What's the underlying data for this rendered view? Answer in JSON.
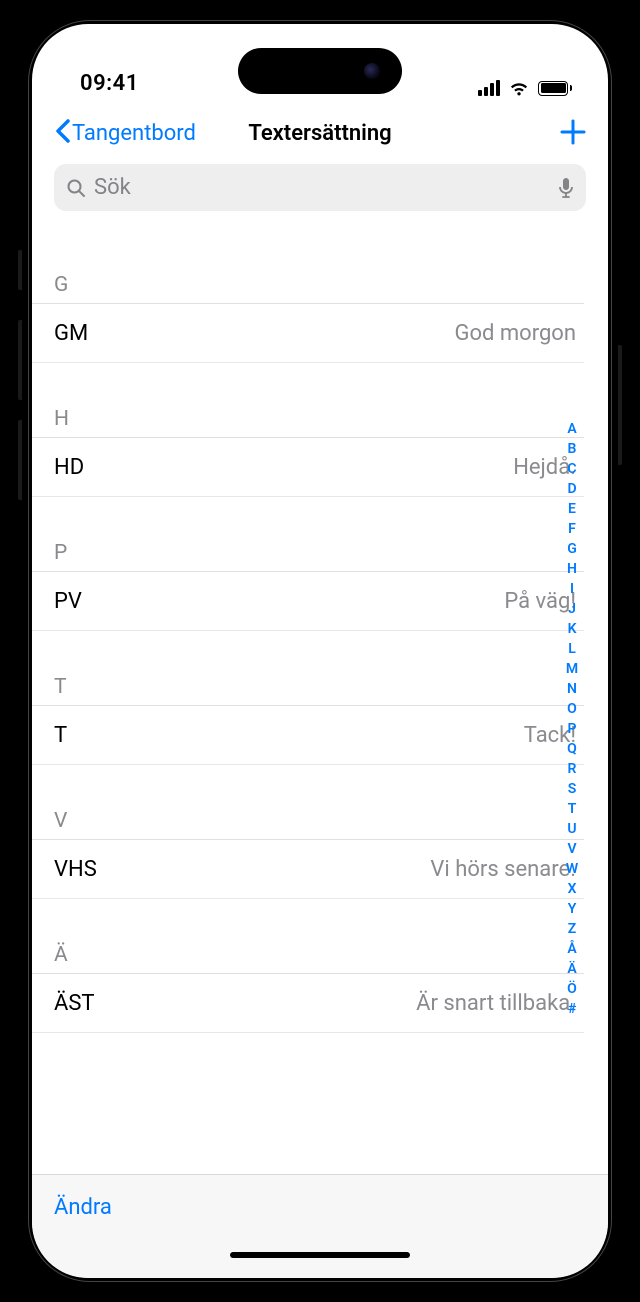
{
  "status": {
    "time": "09:41"
  },
  "nav": {
    "back": "Tangentbord",
    "title": "Textersättning"
  },
  "search": {
    "placeholder": "Sök"
  },
  "sections": [
    {
      "letter": "G",
      "items": [
        {
          "shortcut": "GM",
          "phrase": "God morgon"
        }
      ]
    },
    {
      "letter": "H",
      "items": [
        {
          "shortcut": "HD",
          "phrase": "Hejdå."
        }
      ]
    },
    {
      "letter": "P",
      "items": [
        {
          "shortcut": "PV",
          "phrase": "På väg!"
        }
      ]
    },
    {
      "letter": "T",
      "items": [
        {
          "shortcut": "T",
          "phrase": "Tack!"
        }
      ]
    },
    {
      "letter": "V",
      "items": [
        {
          "shortcut": "VHS",
          "phrase": "Vi hörs senare."
        }
      ]
    },
    {
      "letter": "Ä",
      "items": [
        {
          "shortcut": "ÄST",
          "phrase": "Är snart tillbaka."
        }
      ]
    }
  ],
  "index": [
    "A",
    "B",
    "C",
    "D",
    "E",
    "F",
    "G",
    "H",
    "I",
    "J",
    "K",
    "L",
    "M",
    "N",
    "O",
    "P",
    "Q",
    "R",
    "S",
    "T",
    "U",
    "V",
    "W",
    "X",
    "Y",
    "Z",
    "Å",
    "Ä",
    "Ö",
    "#"
  ],
  "toolbar": {
    "edit": "Ändra"
  }
}
